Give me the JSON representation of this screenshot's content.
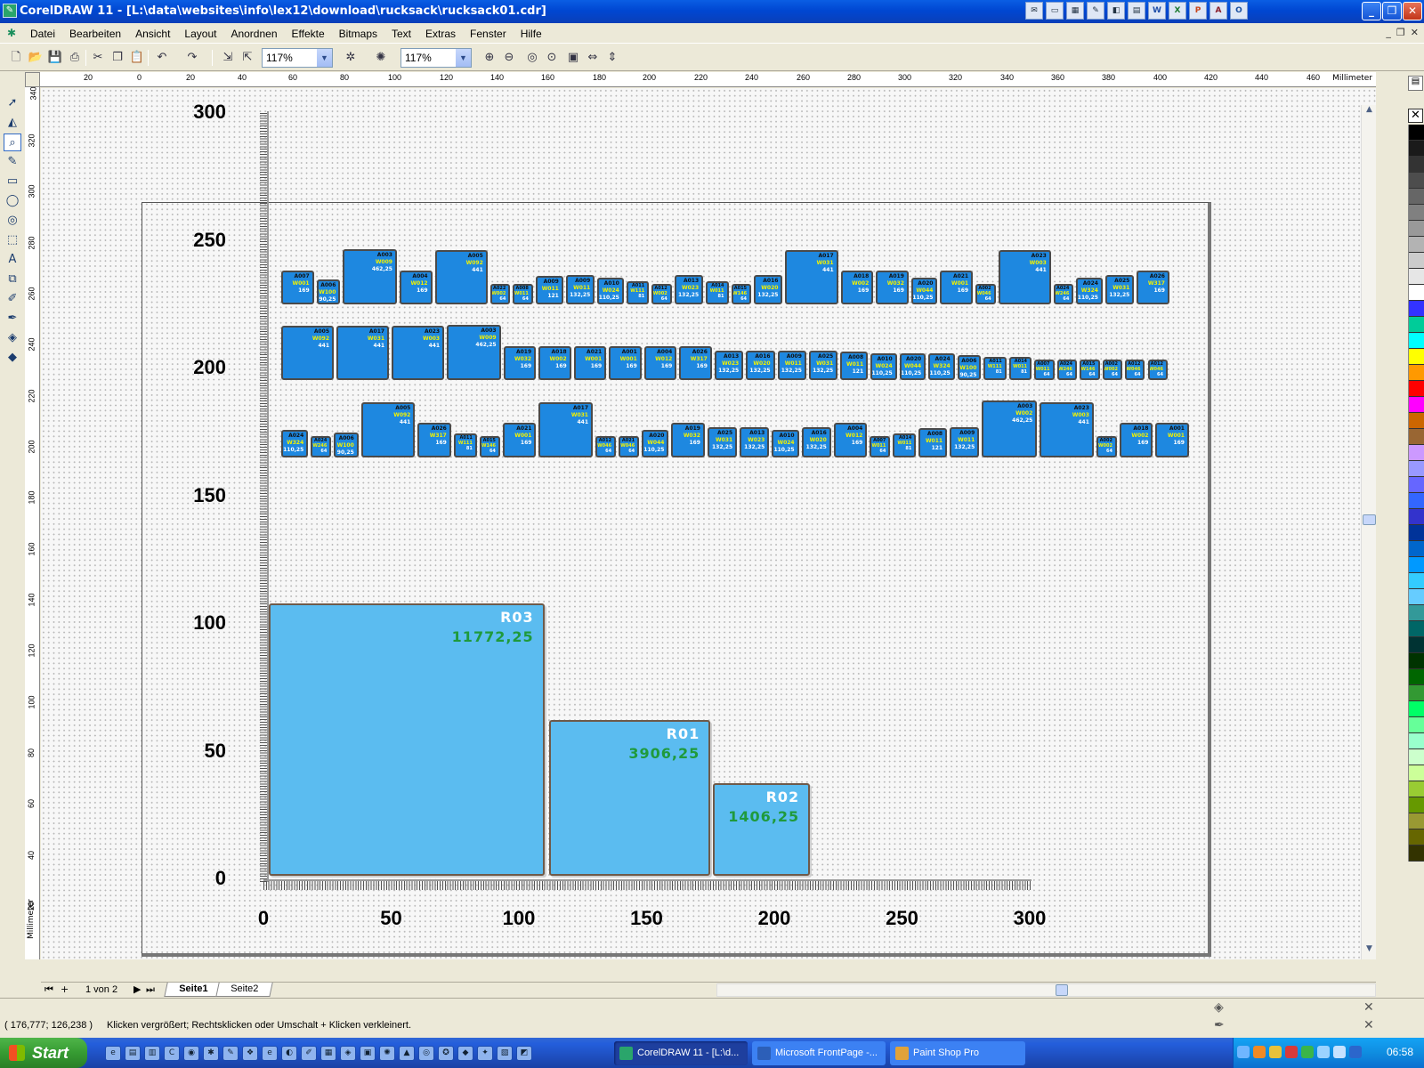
{
  "window": {
    "title": "CorelDRAW 11 - [L:\\data\\websites\\info\\lex12\\download\\rucksack\\rucksack01.cdr]",
    "tray_icons": [
      "mail-icon",
      "window-icon",
      "calendar-icon",
      "notes-icon",
      "explorer-icon",
      "folder-icon",
      "word-icon",
      "excel-icon",
      "powerpoint-icon",
      "access-icon",
      "outlook-icon"
    ]
  },
  "menu": {
    "items": [
      "Datei",
      "Bearbeiten",
      "Ansicht",
      "Layout",
      "Anordnen",
      "Effekte",
      "Bitmaps",
      "Text",
      "Extras",
      "Fenster",
      "Hilfe"
    ]
  },
  "toolbar": {
    "zoom1": "117%",
    "zoom2": "117%"
  },
  "rulers": {
    "unit": "Millimeter",
    "h_labels": [
      "20",
      "0",
      "20",
      "40",
      "60",
      "80",
      "100",
      "120",
      "140",
      "160",
      "180",
      "200",
      "220",
      "240",
      "260",
      "280",
      "300",
      "320",
      "340",
      "360",
      "380",
      "400",
      "420",
      "440",
      "460"
    ],
    "v_labels": [
      "340",
      "320",
      "300",
      "280",
      "260",
      "240",
      "220",
      "200",
      "180",
      "160",
      "140",
      "120",
      "100",
      "80",
      "60",
      "40",
      "20"
    ]
  },
  "chart_data": {
    "type": "bar",
    "description_axes": {
      "x_ticks": [
        "0",
        "50",
        "100",
        "150",
        "200",
        "250",
        "300"
      ],
      "y_ticks": [
        "300",
        "250",
        "200",
        "150",
        "100",
        "50",
        "0"
      ],
      "xlim": [
        0,
        300
      ],
      "ylim": [
        0,
        300
      ]
    },
    "bins": [
      {
        "name": "R03",
        "value": "11772,25",
        "x0": 2,
        "x1": 110,
        "y_top": 108
      },
      {
        "name": "R01",
        "value": "3906,25",
        "x0": 112,
        "x1": 175,
        "y_top": 62.5
      },
      {
        "name": "R02",
        "value": "1406,25",
        "x0": 176,
        "x1": 214,
        "y_top": 37.5
      }
    ],
    "rows": [
      {
        "items": [
          {
            "a": "A007",
            "w": "W001",
            "v": "169"
          },
          {
            "a": "A006",
            "w": "W100",
            "v": "90,25"
          },
          {
            "a": "A003",
            "w": "W009",
            "v": "462,25"
          },
          {
            "a": "A004",
            "w": "W012",
            "v": "169"
          },
          {
            "a": "A005",
            "w": "W092",
            "v": "441"
          },
          {
            "a": "A022",
            "w": "W002",
            "v": "64"
          },
          {
            "a": "A008",
            "w": "W011",
            "v": "64"
          },
          {
            "a": "A009",
            "w": "W011",
            "v": "121"
          },
          {
            "a": "A009",
            "w": "W011",
            "v": "132,25"
          },
          {
            "a": "A010",
            "w": "W024",
            "v": "110,25"
          },
          {
            "a": "A011",
            "w": "W111",
            "v": "81"
          },
          {
            "a": "A012",
            "w": "W002",
            "v": "64"
          },
          {
            "a": "A013",
            "w": "W023",
            "v": "132,25"
          },
          {
            "a": "A014",
            "w": "W011",
            "v": "81"
          },
          {
            "a": "A015",
            "w": "W146",
            "v": "64"
          },
          {
            "a": "A016",
            "w": "W020",
            "v": "132,25"
          },
          {
            "a": "A017",
            "w": "W031",
            "v": "441"
          },
          {
            "a": "A018",
            "w": "W002",
            "v": "169"
          },
          {
            "a": "A019",
            "w": "W032",
            "v": "169"
          },
          {
            "a": "A020",
            "w": "W044",
            "v": "110,25"
          },
          {
            "a": "A021",
            "w": "W001",
            "v": "169"
          },
          {
            "a": "A002",
            "w": "W046",
            "v": "64"
          },
          {
            "a": "A023",
            "w": "W003",
            "v": "441"
          },
          {
            "a": "A024",
            "w": "W246",
            "v": "64"
          },
          {
            "a": "A024",
            "w": "W324",
            "v": "110,25"
          },
          {
            "a": "A025",
            "w": "W031",
            "v": "132,25"
          },
          {
            "a": "A026",
            "w": "W317",
            "v": "169"
          }
        ]
      },
      {
        "items": [
          {
            "a": "A005",
            "w": "W092",
            "v": "441"
          },
          {
            "a": "A017",
            "w": "W031",
            "v": "441"
          },
          {
            "a": "A023",
            "w": "W003",
            "v": "441"
          },
          {
            "a": "A003",
            "w": "W009",
            "v": "462,25"
          },
          {
            "a": "A019",
            "w": "W032",
            "v": "169"
          },
          {
            "a": "A018",
            "w": "W002",
            "v": "169"
          },
          {
            "a": "A021",
            "w": "W001",
            "v": "169"
          },
          {
            "a": "A001",
            "w": "W001",
            "v": "169"
          },
          {
            "a": "A004",
            "w": "W012",
            "v": "169"
          },
          {
            "a": "A026",
            "w": "W317",
            "v": "169"
          },
          {
            "a": "A013",
            "w": "W023",
            "v": "132,25"
          },
          {
            "a": "A016",
            "w": "W020",
            "v": "132,25"
          },
          {
            "a": "A009",
            "w": "W011",
            "v": "132,25"
          },
          {
            "a": "A025",
            "w": "W031",
            "v": "132,25"
          },
          {
            "a": "A008",
            "w": "W011",
            "v": "121"
          },
          {
            "a": "A010",
            "w": "W024",
            "v": "110,25"
          },
          {
            "a": "A020",
            "w": "W044",
            "v": "110,25"
          },
          {
            "a": "A024",
            "w": "W324",
            "v": "110,25"
          },
          {
            "a": "A006",
            "w": "W100",
            "v": "90,25"
          },
          {
            "a": "A011",
            "w": "W111",
            "v": "81"
          },
          {
            "a": "A014",
            "w": "W011",
            "v": "81"
          },
          {
            "a": "A007",
            "w": "W011",
            "v": "64"
          },
          {
            "a": "A024",
            "w": "W246",
            "v": "64"
          },
          {
            "a": "A015",
            "w": "W146",
            "v": "64"
          },
          {
            "a": "A002",
            "w": "W002",
            "v": "64"
          },
          {
            "a": "A012",
            "w": "W046",
            "v": "64"
          },
          {
            "a": "A012",
            "w": "W046",
            "v": "64"
          }
        ]
      },
      {
        "items": [
          {
            "a": "A024",
            "w": "W324",
            "v": "110,25"
          },
          {
            "a": "A024",
            "w": "W246",
            "v": "64"
          },
          {
            "a": "A006",
            "w": "W100",
            "v": "90,25"
          },
          {
            "a": "A005",
            "w": "W092",
            "v": "441"
          },
          {
            "a": "A026",
            "w": "W317",
            "v": "169"
          },
          {
            "a": "A011",
            "w": "W111",
            "v": "81"
          },
          {
            "a": "A015",
            "w": "W146",
            "v": "64"
          },
          {
            "a": "A021",
            "w": "W001",
            "v": "169"
          },
          {
            "a": "A017",
            "w": "W031",
            "v": "441"
          },
          {
            "a": "A012",
            "w": "W046",
            "v": "64"
          },
          {
            "a": "A021",
            "w": "W046",
            "v": "64"
          },
          {
            "a": "A020",
            "w": "W044",
            "v": "110,25"
          },
          {
            "a": "A019",
            "w": "W032",
            "v": "169"
          },
          {
            "a": "A025",
            "w": "W031",
            "v": "132,25"
          },
          {
            "a": "A013",
            "w": "W023",
            "v": "132,25"
          },
          {
            "a": "A010",
            "w": "W024",
            "v": "110,25"
          },
          {
            "a": "A016",
            "w": "W020",
            "v": "132,25"
          },
          {
            "a": "A004",
            "w": "W012",
            "v": "169"
          },
          {
            "a": "A007",
            "w": "W011",
            "v": "64"
          },
          {
            "a": "A014",
            "w": "W011",
            "v": "81"
          },
          {
            "a": "A008",
            "w": "W011",
            "v": "121"
          },
          {
            "a": "A009",
            "w": "W011",
            "v": "132,25"
          },
          {
            "a": "A003",
            "w": "W002",
            "v": "462,25"
          },
          {
            "a": "A023",
            "w": "W003",
            "v": "441"
          },
          {
            "a": "A002",
            "w": "W002",
            "v": "64"
          },
          {
            "a": "A018",
            "w": "W002",
            "v": "169"
          },
          {
            "a": "A001",
            "w": "W001",
            "v": "169"
          }
        ]
      }
    ]
  },
  "pagebar": {
    "count": "1 von 2",
    "tabs": [
      "Seite1",
      "Seite2"
    ]
  },
  "status": {
    "coords": "( 176,777; 126,238 )",
    "hint": "Klicken vergrößert; Rechtsklicken oder Umschalt + Klicken verkleinert."
  },
  "taskbar": {
    "start": "Start",
    "tasks": [
      "CorelDRAW 11 - [L:\\d...",
      "Microsoft FrontPage -...",
      "Paint Shop Pro"
    ],
    "clock": "06:58"
  },
  "palette_colors": [
    "#000000",
    "#1a1a1a",
    "#333333",
    "#4d4d4d",
    "#666666",
    "#808080",
    "#999999",
    "#b3b3b3",
    "#cccccc",
    "#e6e6e6",
    "#ffffff",
    "#3333ff",
    "#00cc99",
    "#00ffff",
    "#ffff00",
    "#ff9900",
    "#ff0000",
    "#ff00ff",
    "#cc6600",
    "#996633",
    "#cc99ff",
    "#9999ff",
    "#6666ff",
    "#3366ff",
    "#3333cc",
    "#003399",
    "#0066cc",
    "#0099ff",
    "#33ccff",
    "#66ccff",
    "#339999",
    "#006666",
    "#003333",
    "#003300",
    "#006600",
    "#339933",
    "#00ff66",
    "#66ff99",
    "#99ffcc",
    "#ccffcc",
    "#ccff99",
    "#99cc33",
    "#669900",
    "#999933",
    "#666600",
    "#333300"
  ]
}
